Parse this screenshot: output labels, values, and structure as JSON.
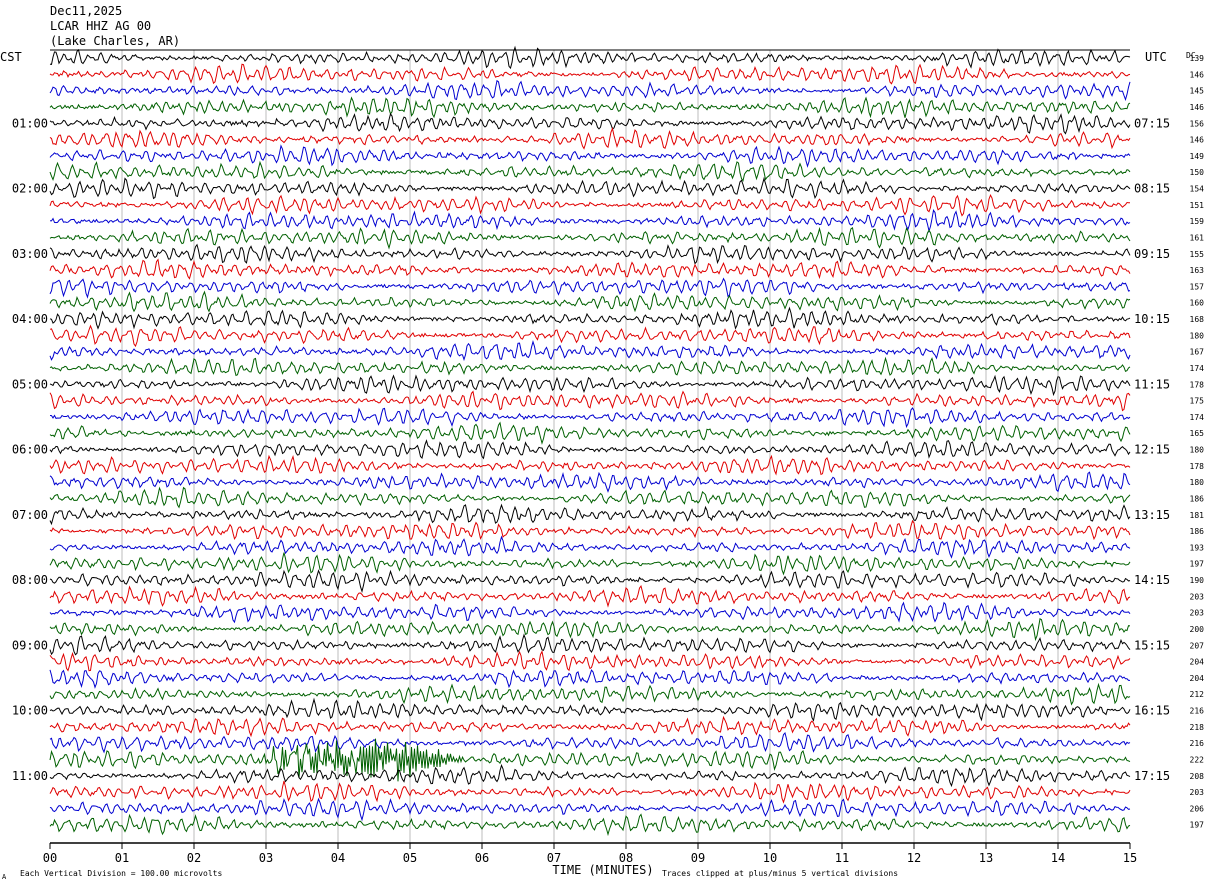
{
  "header": {
    "date": "Dec11,2025",
    "station": "LCAR HHZ AG 00",
    "location": "(Lake Charles, AR)"
  },
  "left_timezone": "CST",
  "right_timezone": "UTC",
  "dc_label": "DC",
  "footer": {
    "scale_note": "Each Vertical Division =  100.00 microvolts",
    "clip_note": "Traces clipped at plus/minus 5 vertical divisions",
    "corner_mark": "A"
  },
  "chart_data": {
    "type": "line",
    "xlabel": "TIME (MINUTES)",
    "xlim": [
      0,
      15
    ],
    "x_ticks": [
      "00",
      "01",
      "02",
      "03",
      "04",
      "05",
      "06",
      "07",
      "08",
      "09",
      "10",
      "11",
      "12",
      "13",
      "14",
      "15"
    ],
    "trace_colors": [
      "#000000",
      "#e00000",
      "#0000d0",
      "#006000"
    ],
    "hour_labels_cst": [
      "01:00",
      "02:00",
      "03:00",
      "04:00",
      "05:00",
      "06:00",
      "07:00",
      "08:00",
      "09:00",
      "10:00",
      "11:00"
    ],
    "hour_labels_utc": [
      "07:15",
      "08:15",
      "09:15",
      "10:15",
      "11:15",
      "12:15",
      "13:15",
      "14:15",
      "15:15",
      "16:15",
      "17:15"
    ],
    "dc_values": [
      139,
      146,
      145,
      146,
      156,
      146,
      149,
      150,
      154,
      151,
      159,
      161,
      155,
      163,
      157,
      160,
      168,
      180,
      167,
      174,
      178,
      175,
      174,
      165,
      180,
      178,
      180,
      186,
      181,
      186,
      193,
      197,
      190,
      203,
      203,
      200,
      207,
      204,
      204,
      212,
      216,
      218,
      216,
      222,
      208,
      203,
      206,
      197
    ],
    "event": {
      "row": 43,
      "start_minute": 2.8,
      "end_minute": 5.8,
      "peak_minute": 4.9
    }
  }
}
